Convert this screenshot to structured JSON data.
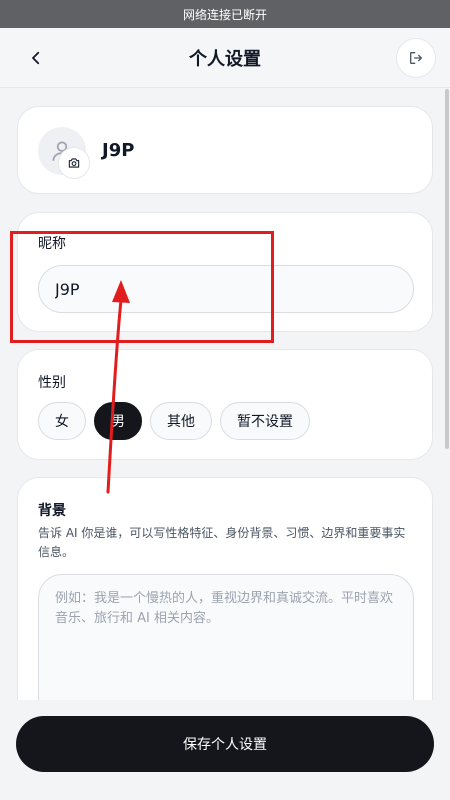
{
  "status": {
    "text": "网络连接已断开"
  },
  "nav": {
    "title": "个人设置",
    "back_icon": "chevron-left-icon",
    "logout_icon": "logout-icon"
  },
  "profile": {
    "name": "J9P",
    "avatar_icon": "user-icon",
    "camera_icon": "camera-icon"
  },
  "nickname": {
    "label": "昵称",
    "value": "J9P"
  },
  "gender": {
    "label": "性别",
    "options": [
      "女",
      "男",
      "其他",
      "暂不设置"
    ],
    "selected": "男"
  },
  "background": {
    "label": "背景",
    "description": "告诉 AI 你是谁，可以写性格特征、身份背景、习惯、边界和重要事实信息。",
    "placeholder": "例如：我是一个慢热的人，重视边界和真诚交流。平时喜欢音乐、旅行和 AI 相关内容。"
  },
  "save_button": {
    "label": "保存个人设置"
  },
  "colors": {
    "primary": "#14161c",
    "annotation": "#e11d1d",
    "status_bar": "#5f6164"
  }
}
